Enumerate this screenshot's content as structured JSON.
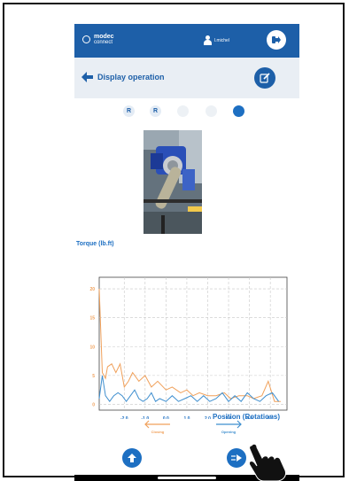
{
  "header": {
    "logo_line1": "modec",
    "logo_line2": "connect",
    "username": "l.michel"
  },
  "subheader": {
    "title": "Display operation"
  },
  "steps": [
    {
      "label": "R",
      "state": "done"
    },
    {
      "label": "R",
      "state": "done"
    },
    {
      "label": "",
      "state": "pending"
    },
    {
      "label": "",
      "state": "pending"
    },
    {
      "label": "",
      "state": "active"
    }
  ],
  "chart_title": "Torque (lb.ft)",
  "chart_data": {
    "type": "line",
    "xlabel": "Position (Rotations)",
    "ylabel": "Torque (lb.ft)",
    "xlim": [
      -3.2,
      5.8
    ],
    "ylim": [
      -1,
      22
    ],
    "x_ticks": [
      -2.0,
      -1.0,
      0.0,
      1.0,
      2.0,
      3.0,
      4.0,
      5.0
    ],
    "x_tick_labels": [
      "-2.0",
      "-1.0",
      "0.0",
      "1.0",
      "2.0",
      "3.0",
      "4.0",
      "5.0"
    ],
    "y_ticks": [
      0,
      5,
      10,
      15,
      20
    ],
    "y_tick_labels": [
      "0",
      "5",
      "10",
      "15",
      "20"
    ],
    "grid": true,
    "series": [
      {
        "name": "Closing",
        "color": "#f0a05a",
        "x": [
          -3.2,
          -3.05,
          -2.9,
          -2.8,
          -2.6,
          -2.4,
          -2.2,
          -2.0,
          -1.8,
          -1.6,
          -1.3,
          -1.0,
          -0.7,
          -0.4,
          0.0,
          0.3,
          0.7,
          1.0,
          1.3,
          1.6,
          2.0,
          2.4,
          2.8,
          3.1,
          3.5,
          3.9,
          4.2,
          4.6,
          4.9,
          5.2,
          5.5
        ],
        "y": [
          20,
          5.5,
          4.5,
          6.5,
          7,
          5.5,
          7,
          3,
          4,
          5.5,
          4,
          5,
          3,
          4,
          2.5,
          3,
          2,
          2.5,
          1.5,
          2,
          1.5,
          1.5,
          2,
          1,
          1.5,
          1.5,
          1,
          1.5,
          4,
          0.5,
          0.5
        ]
      },
      {
        "name": "Opening",
        "color": "#3f8fcf",
        "x": [
          -3.2,
          -3.05,
          -2.9,
          -2.7,
          -2.5,
          -2.3,
          -2.1,
          -1.9,
          -1.7,
          -1.5,
          -1.3,
          -1.1,
          -0.9,
          -0.7,
          -0.5,
          -0.3,
          0.0,
          0.3,
          0.6,
          0.9,
          1.2,
          1.5,
          1.8,
          2.1,
          2.4,
          2.7,
          3.0,
          3.3,
          3.6,
          3.9,
          4.2,
          4.5,
          4.8,
          5.1,
          5.4
        ],
        "y": [
          1,
          5,
          1.5,
          0.5,
          1.5,
          2,
          1.5,
          0.5,
          1.5,
          2.5,
          1,
          0.5,
          1,
          2,
          0.5,
          1,
          0.5,
          1.5,
          0.5,
          1,
          1.5,
          0.5,
          1.5,
          0.5,
          1,
          2,
          0.5,
          1.5,
          0.5,
          2,
          1,
          0.5,
          1.5,
          2,
          0.5
        ]
      }
    ]
  },
  "legend": {
    "closing": "Closing",
    "opening": "Opening"
  },
  "colors": {
    "primary": "#1d5fa8",
    "accent": "#1d6fc2",
    "closing": "#f0a05a",
    "opening": "#3f8fcf"
  }
}
